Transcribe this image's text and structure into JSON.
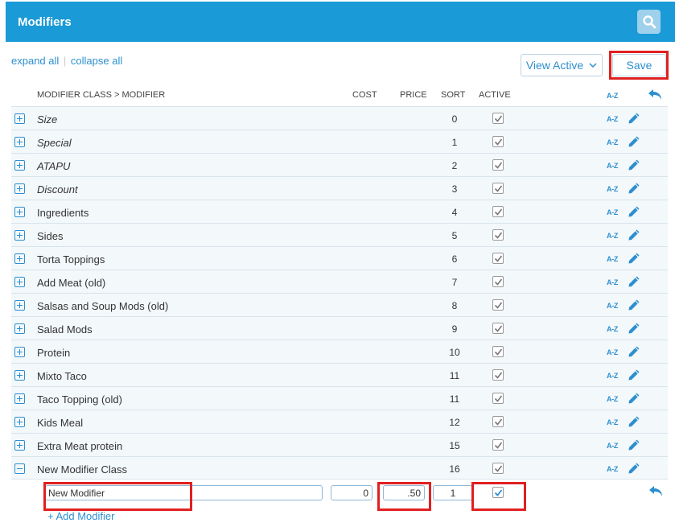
{
  "header": {
    "title": "Modifiers",
    "search_icon": "search-icon"
  },
  "links": {
    "expand_all": "expand all",
    "separator": "|",
    "collapse_all": "collapse all"
  },
  "toolbar": {
    "view_active": "View Active",
    "save": "Save"
  },
  "columns": {
    "class_modifier": "MODIFIER CLASS > MODIFIER",
    "cost": "COST",
    "price": "PRICE",
    "sort": "SORT",
    "active": "ACTIVE",
    "az": "A-Z"
  },
  "rows": [
    {
      "name": "Size",
      "sort": "0",
      "italic": true,
      "expanded": false,
      "active": true
    },
    {
      "name": "Special",
      "sort": "1",
      "italic": true,
      "expanded": false,
      "active": true
    },
    {
      "name": "ATAPU",
      "sort": "2",
      "italic": true,
      "expanded": false,
      "active": true
    },
    {
      "name": "Discount",
      "sort": "3",
      "italic": true,
      "expanded": false,
      "active": true
    },
    {
      "name": "Ingredients",
      "sort": "4",
      "italic": false,
      "expanded": false,
      "active": true
    },
    {
      "name": "Sides",
      "sort": "5",
      "italic": false,
      "expanded": false,
      "active": true
    },
    {
      "name": "Torta Toppings",
      "sort": "6",
      "italic": false,
      "expanded": false,
      "active": true
    },
    {
      "name": "Add Meat (old)",
      "sort": "7",
      "italic": false,
      "expanded": false,
      "active": true
    },
    {
      "name": "Salsas and Soup Mods (old)",
      "sort": "8",
      "italic": false,
      "expanded": false,
      "active": true
    },
    {
      "name": "Salad Mods",
      "sort": "9",
      "italic": false,
      "expanded": false,
      "active": true
    },
    {
      "name": "Protein",
      "sort": "10",
      "italic": false,
      "expanded": false,
      "active": true
    },
    {
      "name": "Mixto Taco",
      "sort": "11",
      "italic": false,
      "expanded": false,
      "active": true
    },
    {
      "name": "Taco Topping (old)",
      "sort": "11",
      "italic": false,
      "expanded": false,
      "active": true
    },
    {
      "name": "Kids Meal",
      "sort": "12",
      "italic": false,
      "expanded": false,
      "active": true
    },
    {
      "name": "Extra Meat protein",
      "sort": "15",
      "italic": false,
      "expanded": false,
      "active": true
    },
    {
      "name": "New Modifier Class",
      "sort": "16",
      "italic": false,
      "expanded": true,
      "active": true
    }
  ],
  "new_modifier": {
    "name": "New Modifier",
    "cost": "0",
    "price": ".50",
    "sort": "1",
    "active": true
  },
  "add_modifier": "+ Add Modifier",
  "colors": {
    "header": "#1a9ad6",
    "link": "#2d8fcf",
    "highlight": "#e02020"
  }
}
